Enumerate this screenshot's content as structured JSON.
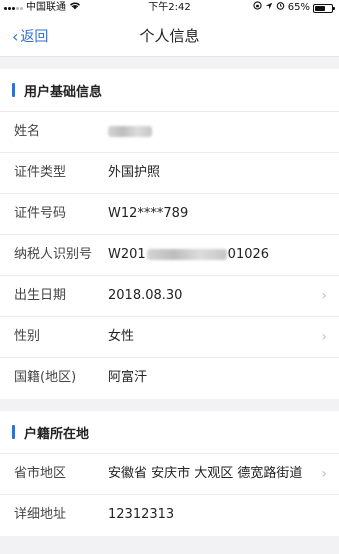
{
  "status_bar": {
    "carrier": "中国联通",
    "time": "下午2:42",
    "battery_text": "65%",
    "battery_level": 0.65
  },
  "nav": {
    "back_label": "返回",
    "title": "个人信息"
  },
  "colors": {
    "accent": "#2f6fd6",
    "background": "#f2f2f4"
  },
  "basic_info": {
    "header": "用户基础信息",
    "rows": [
      {
        "label": "姓名",
        "value": ""
      },
      {
        "label": "证件类型",
        "value": "外国护照"
      },
      {
        "label": "证件号码",
        "value": "W12****789"
      },
      {
        "label": "纳税人识别号",
        "value_prefix": "W201",
        "value_suffix": "01026"
      },
      {
        "label": "出生日期",
        "value": "2018.08.30",
        "has_arrow": true
      },
      {
        "label": "性别",
        "value": "女性",
        "has_arrow": true
      },
      {
        "label": "国籍(地区)",
        "value": "阿富汗"
      }
    ]
  },
  "household": {
    "header": "户籍所在地",
    "rows": [
      {
        "label": "省市地区",
        "value": "安徽省 安庆市 大观区 德宽路街道",
        "has_arrow": true
      },
      {
        "label": "详细地址",
        "value": "12312313"
      }
    ]
  }
}
